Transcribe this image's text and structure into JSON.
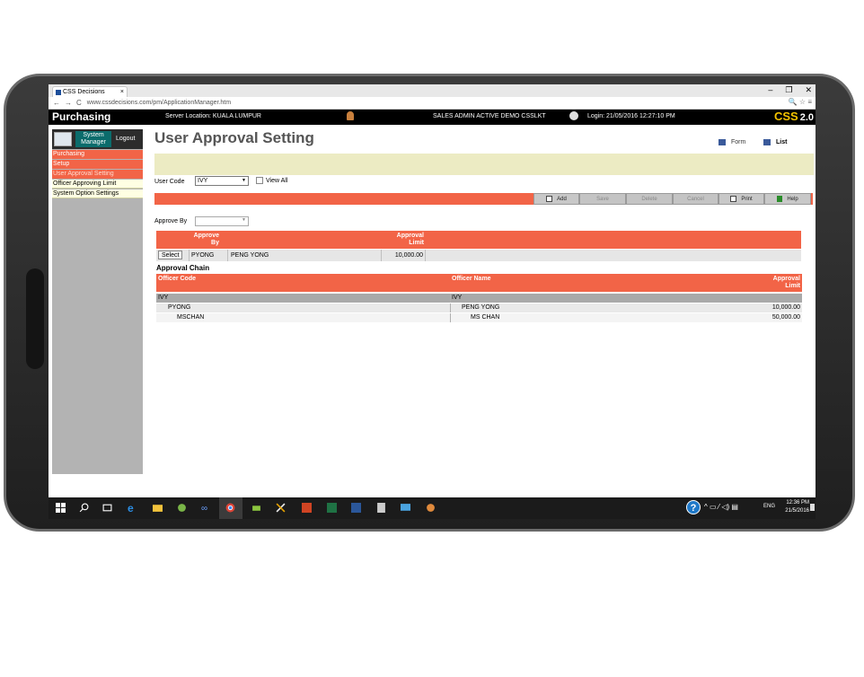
{
  "browser": {
    "tab_title": "CSS Decisions",
    "tab_close": "×",
    "url": "www.cssdecisions.com/pm/ApplicationManager.htm",
    "controls": [
      "–",
      "❐",
      "✕"
    ],
    "nav": [
      "←",
      "→",
      "C"
    ],
    "addr_icons": "🔍 ☆ ≡"
  },
  "header": {
    "app_name": "Purchasing",
    "server_location": "Server Location: KUALA LUMPUR",
    "user_status": "SALES ADMIN ACTIVE DEMO    CSSLKT",
    "login": "Login: 21/05/2016 12:27:10 PM",
    "logo": "CSS",
    "logo_version": "2.0"
  },
  "sidebar": {
    "system_manager": "System Manager",
    "logout": "Logout",
    "items": [
      "Purchasing",
      "Setup",
      "User Approval Setting",
      "Officer Approving Limit",
      "System Option Settings"
    ]
  },
  "page": {
    "title": "User Approval Setting",
    "view_form": "Form",
    "view_list": "List",
    "user_code_label": "User Code",
    "user_code_value": "IVY",
    "view_all_label": "View All",
    "approve_by_label": "Approve By",
    "approve_by_value": ""
  },
  "toolbar": {
    "add": "Add",
    "save": "Save",
    "delete": "Delete",
    "cancel": "Cancel",
    "print": "Print",
    "help": "Help"
  },
  "approve_grid": {
    "headers": [
      "Approve By",
      "Approval Limit"
    ],
    "rows": [
      {
        "action": "Select",
        "code": "PYONG",
        "name": "PENG YONG",
        "limit": "10,000.00"
      }
    ]
  },
  "approval_chain": {
    "title": "Approval Chain",
    "headers": [
      "Officer Code",
      "Officer Name",
      "Approval Limit"
    ],
    "rows": [
      {
        "code": "IVY",
        "name": "IVY",
        "limit": ""
      },
      {
        "code": "PYONG",
        "name": "PENG YONG",
        "limit": "10,000.00"
      },
      {
        "code": "MSCHAN",
        "name": "MS CHAN",
        "limit": "50,000.00"
      }
    ]
  },
  "taskbar": {
    "tray_help": "?",
    "tray_icons": "^ ▭ ⁄ ◁) ▤",
    "language": "ENG",
    "time": "12:36 PM",
    "date": "21/5/2016"
  }
}
